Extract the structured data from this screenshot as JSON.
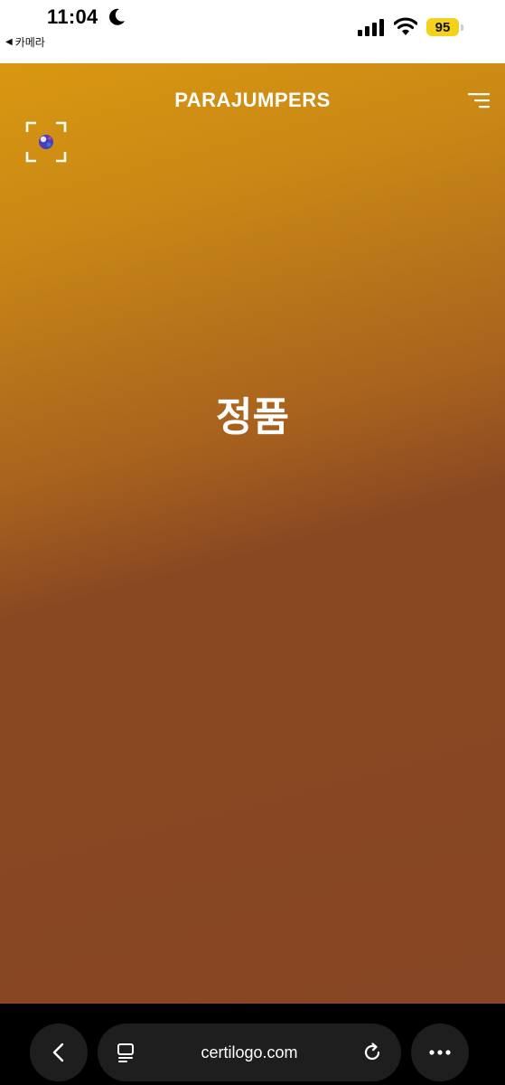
{
  "status_bar": {
    "time": "11:04",
    "back_app_label": "카메라",
    "battery_level": "95",
    "icons": [
      "moon-icon",
      "signal-icon",
      "wifi-icon",
      "battery-icon"
    ]
  },
  "page": {
    "brand": "PARAJUMPERS",
    "headline": "정품",
    "icons": [
      "menu-icon",
      "scan-icon"
    ],
    "colors": {
      "gradient_top": "#d99810",
      "gradient_bottom": "#874623",
      "text": "#ffffff"
    }
  },
  "browser": {
    "url": "certilogo.com",
    "icons": [
      "chevron-left-icon",
      "tabs-icon",
      "reload-icon",
      "more-icon"
    ]
  }
}
